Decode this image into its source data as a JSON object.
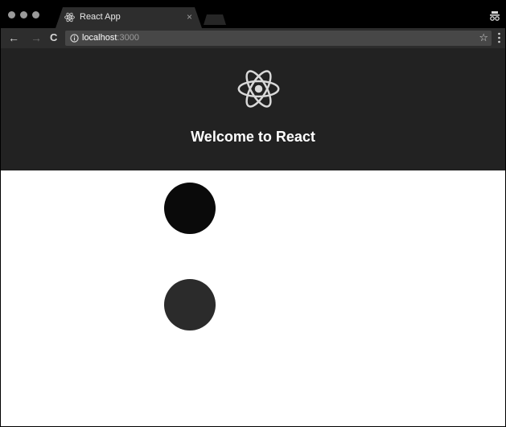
{
  "browser": {
    "tab": {
      "title": "React App",
      "close_label": "×",
      "favicon": "react-logo-icon"
    },
    "toolbar": {
      "back_label": "←",
      "forward_label": "→",
      "reload_label": "C",
      "url_host": "localhost",
      "url_port": ":3000",
      "bookmark_label": "☆"
    }
  },
  "app": {
    "header_title": "Welcome to React",
    "logo": "react-logo-icon"
  },
  "content": {
    "circles": [
      {
        "color": "#0a0a0a"
      },
      {
        "color": "#2b2b2b"
      }
    ]
  },
  "colors": {
    "tabstrip": "#000000",
    "toolbar": "#2d2d2d",
    "header": "#222222",
    "page": "#ffffff"
  }
}
